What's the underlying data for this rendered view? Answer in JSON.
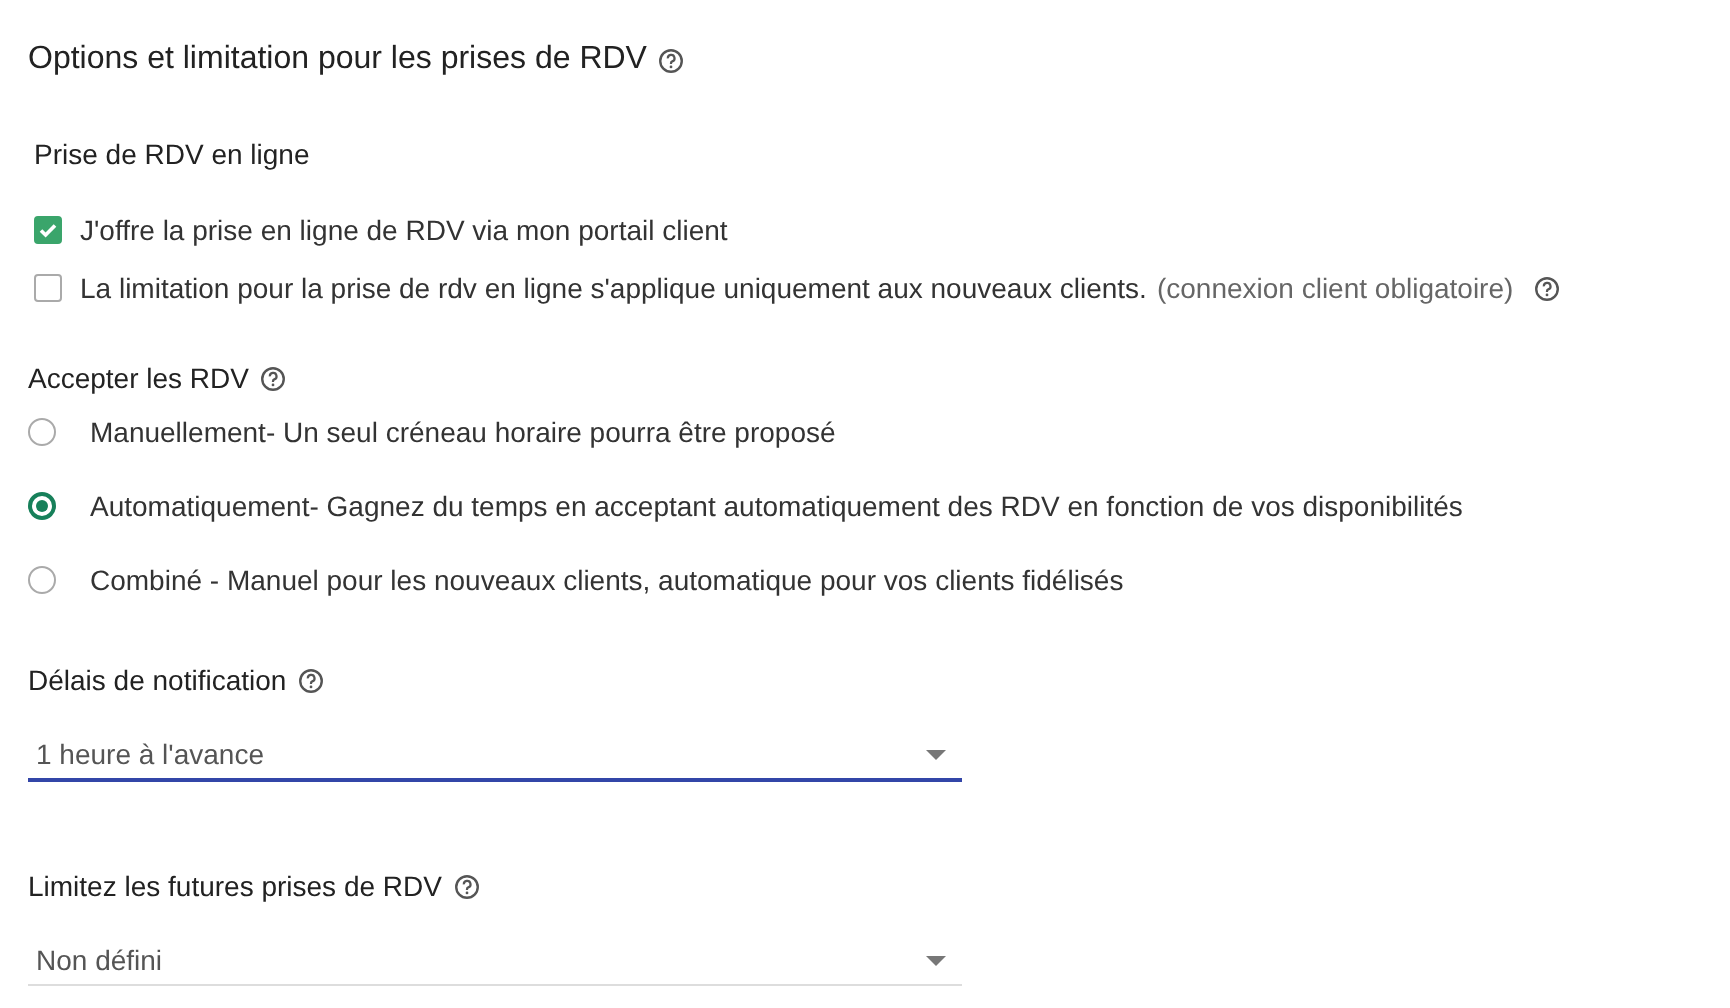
{
  "title": {
    "text": "Options et limitation pour les prises de RDV",
    "help": true
  },
  "online": {
    "heading": "Prise de RDV en ligne",
    "options": [
      {
        "label": "J'offre la prise en ligne de RDV via mon portail client",
        "checked": true
      },
      {
        "label": "La limitation pour la prise de rdv en ligne s'applique uniquement aux nouveaux clients.",
        "hint": "(connexion client obligatoire)",
        "help": true,
        "checked": false
      }
    ]
  },
  "accept": {
    "heading": "Accepter les RDV",
    "help": true,
    "options": [
      {
        "label": "Manuellement- Un seul créneau horaire pourra être proposé",
        "selected": false
      },
      {
        "label": "Automatiquement- Gagnez du temps en acceptant automatiquement des RDV en fonction de vos disponibilités",
        "selected": true
      },
      {
        "label": "Combiné - Manuel pour les nouveaux clients, automatique pour vos clients fidélisés",
        "selected": false
      }
    ]
  },
  "selects": [
    {
      "label": "Délais de notification",
      "help": true,
      "value": "1 heure à l'avance",
      "focused": true
    },
    {
      "label": "Limitez les futures prises de RDV",
      "help": true,
      "value": "Non défini",
      "focused": false
    }
  ]
}
